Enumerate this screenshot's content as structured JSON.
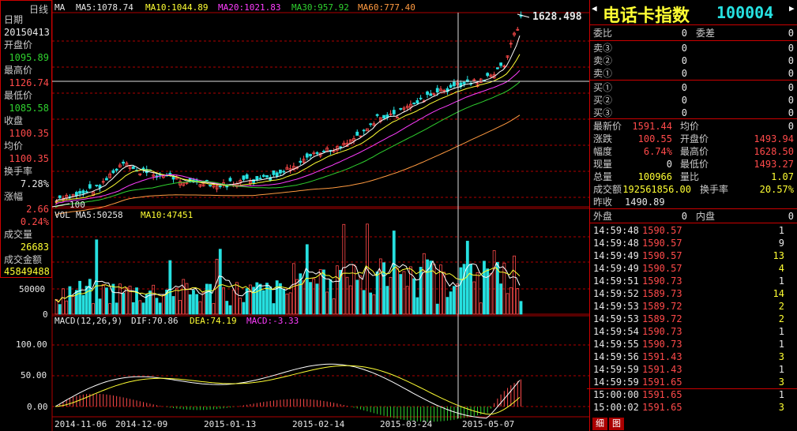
{
  "title": {
    "name": "电话卡指数",
    "code": "100004"
  },
  "left_info": {
    "period": "日线",
    "date_label": "日期",
    "date": "20150413",
    "open_label": "开盘价",
    "open": "1095.89",
    "high_label": "最高价",
    "high": "1126.74",
    "low_label": "最低价",
    "low": "1085.58",
    "close_label": "收盘",
    "close": "1100.35",
    "avg_label": "均价",
    "avg": "1100.35",
    "turnover_label": "换手率",
    "turnover": "7.28%",
    "change_label": "涨幅",
    "change": "2.66",
    "change_pct": "0.24%",
    "vol_label": "成交量",
    "vol": "26683",
    "amount_label": "成交金额",
    "amount": "45849488"
  },
  "ma_legend": {
    "ma": "MA",
    "ma5": "MA5:1078.74",
    "ma10": "MA10:1044.89",
    "ma20": "MA20:1021.83",
    "ma30": "MA30:957.92",
    "ma60": "MA60:777.40"
  },
  "price_labels": {
    "peak": "1628.498",
    "base": "100"
  },
  "vol_legend": {
    "vol": "VOL",
    "ma5": "MA5:50258",
    "ma10": "MA10:47451"
  },
  "vol_axis": {
    "t50000": "50000",
    "t0": "0"
  },
  "macd_legend": {
    "macd": "MACD(12,26,9)",
    "dif": "DIF:70.86",
    "dea": "DEA:74.19",
    "m": "MACD:-3.33"
  },
  "macd_axis": {
    "t100": "100.00",
    "t50": "50.00",
    "t0": "0.00"
  },
  "x_dates": [
    "2014-11-06",
    "2014-12-09",
    "2015-01-13",
    "2015-02-14",
    "2015-03-24",
    "2015-05-07"
  ],
  "quote": {
    "weibi_label": "委比",
    "weibi": "0",
    "weicha_label": "委差",
    "weicha": "0",
    "sell": [
      {
        "label": "卖③",
        "price": "0",
        "vol": "0"
      },
      {
        "label": "卖②",
        "price": "0",
        "vol": "0"
      },
      {
        "label": "卖①",
        "price": "0",
        "vol": "0"
      }
    ],
    "buy": [
      {
        "label": "买①",
        "price": "0",
        "vol": "0"
      },
      {
        "label": "买②",
        "price": "0",
        "vol": "0"
      },
      {
        "label": "买③",
        "price": "0",
        "vol": "0"
      }
    ],
    "last_label": "最新价",
    "last": "1591.44",
    "avg_label": "均价",
    "avg": "0",
    "chg_label": "涨跌",
    "chg": "100.55",
    "open_label": "开盘价",
    "open": "1493.94",
    "pct_label": "幅度",
    "pct": "6.74%",
    "high_label": "最高价",
    "high": "1628.50",
    "now_label": "现量",
    "now": "0",
    "low_label": "最低价",
    "low": "1493.27",
    "total_label": "总量",
    "total": "100966",
    "lb_label": "量比",
    "lb": "1.07",
    "amt_label": "成交额",
    "amt": "192561856.00",
    "turn_label": "换手率",
    "turn": "20.57%",
    "prev_label": "昨收",
    "prev": "1490.89",
    "out_label": "外盘",
    "out": "0",
    "in_label": "内盘",
    "in": "0"
  },
  "ticks": [
    {
      "t": "14:59:48",
      "p": "1590.57",
      "v": "1",
      "vc": "wht"
    },
    {
      "t": "14:59:48",
      "p": "1590.57",
      "v": "9",
      "vc": "wht"
    },
    {
      "t": "14:59:49",
      "p": "1590.57",
      "v": "13",
      "vc": "yel"
    },
    {
      "t": "14:59:49",
      "p": "1590.57",
      "v": "4",
      "vc": "yel"
    },
    {
      "t": "14:59:51",
      "p": "1590.73",
      "v": "1",
      "vc": "wht"
    },
    {
      "t": "14:59:52",
      "p": "1589.73",
      "v": "14",
      "vc": "yel"
    },
    {
      "t": "14:59:53",
      "p": "1589.72",
      "v": "2",
      "vc": "yel"
    },
    {
      "t": "14:59:53",
      "p": "1589.72",
      "v": "2",
      "vc": "yel"
    },
    {
      "t": "14:59:54",
      "p": "1590.73",
      "v": "1",
      "vc": "wht"
    },
    {
      "t": "14:59:55",
      "p": "1590.73",
      "v": "1",
      "vc": "wht"
    },
    {
      "t": "14:59:56",
      "p": "1591.43",
      "v": "3",
      "vc": "yel"
    },
    {
      "t": "14:59:59",
      "p": "1591.43",
      "v": "1",
      "vc": "wht"
    },
    {
      "t": "14:59:59",
      "p": "1591.65",
      "v": "3",
      "vc": "yel"
    },
    {
      "t": "15:00:00",
      "p": "1591.65",
      "v": "1",
      "vc": "wht"
    },
    {
      "t": "15:00:02",
      "p": "1591.65",
      "v": "3",
      "vc": "yel"
    }
  ],
  "tabs": {
    "detail": "细",
    "chart": "图"
  },
  "colors": {
    "up": "#ff4a4a",
    "down": "#26e0e0",
    "grid": "#b00000",
    "bg": "#000000"
  }
}
